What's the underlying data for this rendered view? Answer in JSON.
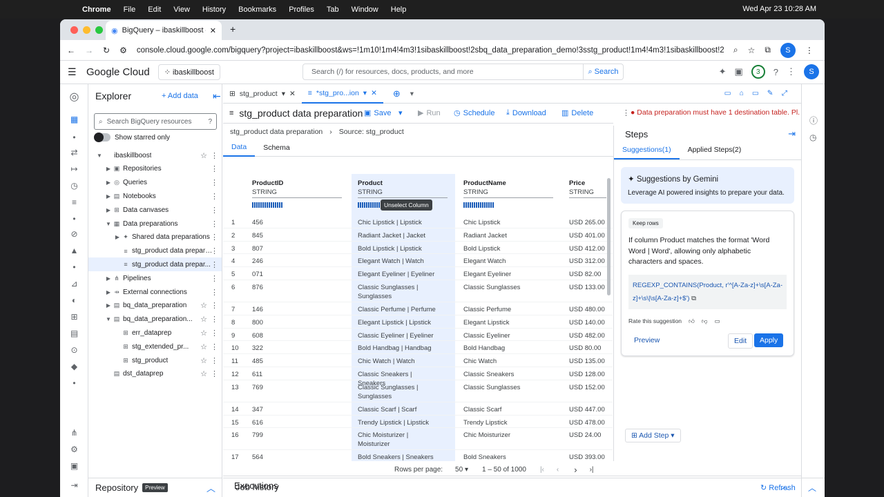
{
  "menubar": {
    "app": "Chrome",
    "items": [
      "File",
      "Edit",
      "View",
      "History",
      "Bookmarks",
      "Profiles",
      "Tab",
      "Window",
      "Help"
    ],
    "clock": "Wed Apr 23  10:28 AM"
  },
  "browser": {
    "tab_title": "BigQuery – ibaskillboost – Go",
    "url": "console.cloud.google.com/bigquery?project=ibaskillboost&ws=!1m10!1m4!4m3!1sibaskillboost!2sbq_data_preparation_demo!3sstg_product!1m4!4m3!1sibaskillboost!2sb...",
    "profile": "S"
  },
  "console": {
    "logo": "Google Cloud",
    "project": "ibaskillboost",
    "search_placeholder": "Search (/) for resources, docs, products, and more",
    "search_btn": "Search",
    "notif": "3",
    "avatar": "S"
  },
  "explorer": {
    "title": "Explorer",
    "add": "Add data",
    "search_ph": "Search BigQuery resources",
    "starred": "Show starred only",
    "tree": [
      {
        "label": "ibaskillboost",
        "indent": 0,
        "arrow": "▼",
        "icon": "",
        "star": true
      },
      {
        "label": "Repositories",
        "indent": 1,
        "arrow": "▶",
        "icon": "▣",
        "star": false
      },
      {
        "label": "Queries",
        "indent": 1,
        "arrow": "▶",
        "icon": "◎",
        "star": false
      },
      {
        "label": "Notebooks",
        "indent": 1,
        "arrow": "▶",
        "icon": "▤",
        "star": false
      },
      {
        "label": "Data canvases",
        "indent": 1,
        "arrow": "▶",
        "icon": "⊞",
        "star": false
      },
      {
        "label": "Data preparations",
        "indent": 1,
        "arrow": "▼",
        "icon": "▦",
        "star": false
      },
      {
        "label": "Shared data preparations",
        "indent": 2,
        "arrow": "▶",
        "icon": "✦",
        "star": false
      },
      {
        "label": "stg_product data prepara...",
        "indent": 2,
        "arrow": "",
        "icon": "≡",
        "star": false
      },
      {
        "label": "stg_product data prepar...",
        "indent": 2,
        "arrow": "",
        "icon": "≡",
        "star": false,
        "sel": true
      },
      {
        "label": "Pipelines",
        "indent": 1,
        "arrow": "▶",
        "icon": "⋔",
        "star": false
      },
      {
        "label": "External connections",
        "indent": 1,
        "arrow": "▶",
        "icon": "⇸",
        "star": false
      },
      {
        "label": "bq_data_preparation",
        "indent": 1,
        "arrow": "▶",
        "icon": "▤",
        "star": true
      },
      {
        "label": "bq_data_preparation...",
        "indent": 1,
        "arrow": "▼",
        "icon": "▤",
        "star": true
      },
      {
        "label": "err_dataprep",
        "indent": 2,
        "arrow": "",
        "icon": "⊞",
        "star": true
      },
      {
        "label": "stg_extended_pr...",
        "indent": 2,
        "arrow": "",
        "icon": "⊞",
        "star": true
      },
      {
        "label": "stg_product",
        "indent": 2,
        "arrow": "",
        "icon": "⊞",
        "star": true
      },
      {
        "label": "dst_dataprep",
        "indent": 1,
        "arrow": "",
        "icon": "▤",
        "star": true
      }
    ],
    "repository": "Repository",
    "preview": "Preview"
  },
  "editor": {
    "tab1": "stg_product",
    "tab2": "*stg_pro...ion",
    "title": "stg_product data preparation",
    "save": "Save",
    "run": "Run",
    "schedule": "Schedule",
    "download": "Download",
    "delete": "Delete",
    "error": "Must have 1 destination table. Pl...",
    "error_full": "Data preparation must have 1 destination table. Pl...",
    "crumb1": "stg_product data preparation",
    "crumb2": "Source: stg_product",
    "tab_data": "Data",
    "tab_schema": "Schema"
  },
  "columns": [
    {
      "name": "ProductID",
      "type": "STRING"
    },
    {
      "name": "Product",
      "type": "STRING"
    },
    {
      "name": "ProductName",
      "type": "STRING"
    },
    {
      "name": "Price",
      "type": "STRING"
    }
  ],
  "tooltip": "Unselect Column",
  "rows": [
    [
      "1",
      "456",
      "Chic Lipstick | Lipstick",
      "Chic Lipstick",
      "USD 265.00"
    ],
    [
      "2",
      "845",
      "Radiant Jacket | Jacket",
      "Radiant Jacket",
      "USD 401.00"
    ],
    [
      "3",
      "807",
      "Bold Lipstick | Lipstick",
      "Bold Lipstick",
      "USD 412.00"
    ],
    [
      "4",
      "246",
      "Elegant Watch | Watch",
      "Elegant Watch",
      "USD 312.00"
    ],
    [
      "5",
      "071",
      "Elegant Eyeliner | Eyeliner",
      "Elegant Eyeliner",
      "USD 82.00"
    ],
    [
      "6",
      "876",
      "Classic Sunglasses | Sunglasses",
      "Classic Sunglasses",
      "USD 133.00"
    ],
    [
      "7",
      "146",
      "Classic Perfume | Perfume",
      "Classic Perfume",
      "USD 480.00"
    ],
    [
      "8",
      "800",
      "Elegant Lipstick | Lipstick",
      "Elegant Lipstick",
      "USD 140.00"
    ],
    [
      "9",
      "608",
      "Classic Eyeliner | Eyeliner",
      "Classic Eyeliner",
      "USD 482.00"
    ],
    [
      "10",
      "322",
      "Bold Handbag | Handbag",
      "Bold Handbag",
      "USD 80.00"
    ],
    [
      "11",
      "485",
      "Chic Watch | Watch",
      "Chic Watch",
      "USD 135.00"
    ],
    [
      "12",
      "611",
      "Classic Sneakers | Sneakers",
      "Classic Sneakers",
      "USD 128.00"
    ],
    [
      "13",
      "769",
      "Classic Sunglasses | Sunglasses",
      "Classic Sunglasses",
      "USD 152.00"
    ],
    [
      "14",
      "347",
      "Classic Scarf | Scarf",
      "Classic Scarf",
      "USD 447.00"
    ],
    [
      "15",
      "616",
      "Trendy Lipstick | Lipstick",
      "Trendy Lipstick",
      "USD 478.00"
    ],
    [
      "16",
      "799",
      "Chic Moisturizer | Moisturizer",
      "Chic Moisturizer",
      "USD 24.00"
    ],
    [
      "17",
      "564",
      "Bold Sneakers | Sneakers",
      "Bold Sneakers",
      "USD 393.00"
    ]
  ],
  "footer": {
    "rows_label": "Rows per page:",
    "rows_val": "50",
    "range": "1 – 50 of 1000"
  },
  "steps": {
    "title": "Steps",
    "tab1": "Suggestions(1)",
    "tab2": "Applied Steps(2)",
    "gemini_title": "Suggestions by Gemini",
    "gemini_sub": "Leverage AI powered insights to prepare your data.",
    "chip": "Keep rows",
    "desc": "If column Product matches the format 'Word Word | Word', allowing only alphabetic characters and spaces.",
    "code": "REGEXP_CONTAINS(Product, r'^[A-Za-z]+\\s[A-Za-z]+\\s\\|\\s[A-Za-z]+$')",
    "rate": "Rate this suggestion",
    "preview": "Preview",
    "edit": "Edit",
    "apply": "Apply",
    "add_step": "Add Step"
  },
  "bottom": {
    "executions": "Executions",
    "job_history": "Job history",
    "refresh": "Refresh"
  }
}
